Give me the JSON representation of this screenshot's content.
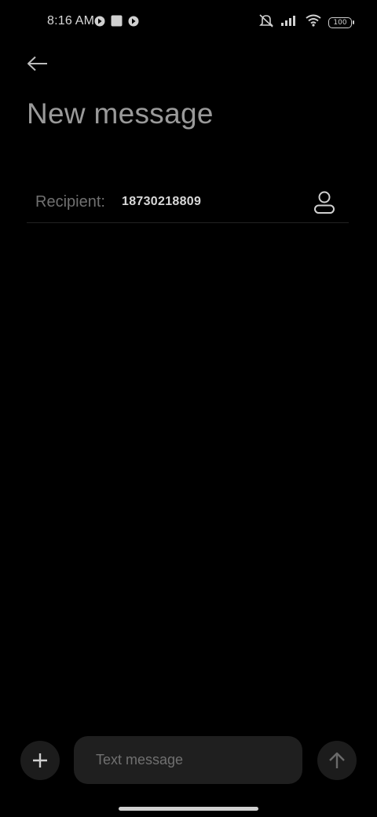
{
  "status_bar": {
    "time": "8:16 AM",
    "battery": "100",
    "icons": [
      "app-notification-icon",
      "square-notification-icon",
      "app-notification-icon",
      "silent-icon",
      "signal-icon",
      "wifi-icon",
      "battery-icon"
    ]
  },
  "header": {
    "title": "New message"
  },
  "recipient": {
    "label": "Recipient:",
    "value": "18730218809"
  },
  "composer": {
    "placeholder": "Text message"
  },
  "colors": {
    "background": "#000000",
    "input_background": "#1f1f1f",
    "button_background": "#1c1c1c"
  }
}
